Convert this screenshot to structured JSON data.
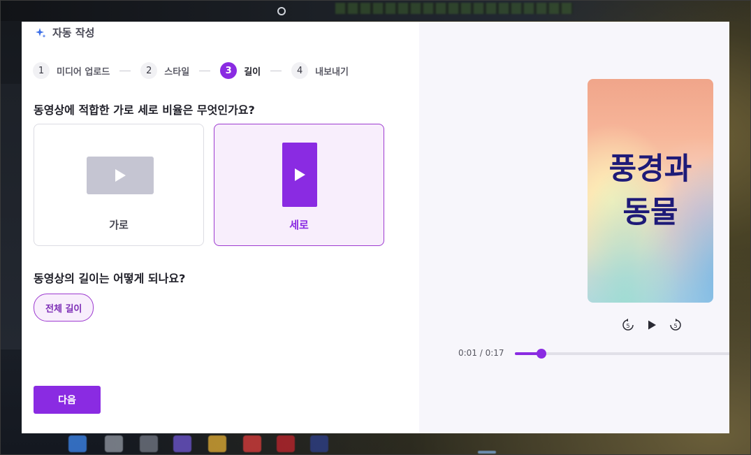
{
  "header": {
    "title": "자동 작성",
    "icon": "sparkle-icon"
  },
  "steps": [
    {
      "num": "1",
      "label": "미디어 업로드",
      "active": false
    },
    {
      "num": "2",
      "label": "스타일",
      "active": false
    },
    {
      "num": "3",
      "label": "길이",
      "active": true
    },
    {
      "num": "4",
      "label": "내보내기",
      "active": false
    }
  ],
  "aspect": {
    "question": "동영상에 적합한 가로 세로 비율은 무엇인가요?",
    "options": [
      {
        "label": "가로",
        "selected": false
      },
      {
        "label": "세로",
        "selected": true
      }
    ]
  },
  "length": {
    "question": "동영상의 길이는 어떻게 되나요?",
    "selected_option": "전체 길이"
  },
  "next_label": "다음",
  "preview": {
    "line1": "풍경과",
    "line2": "동물",
    "time": "0:01 / 0:17",
    "progress_fraction": 0.12,
    "controls": [
      "rewind-5-icon",
      "play-icon",
      "forward-5-icon"
    ]
  },
  "colors": {
    "accent": "#8a2be2",
    "accent_light": "#f8eefc",
    "preview_text": "#1e1a78"
  }
}
